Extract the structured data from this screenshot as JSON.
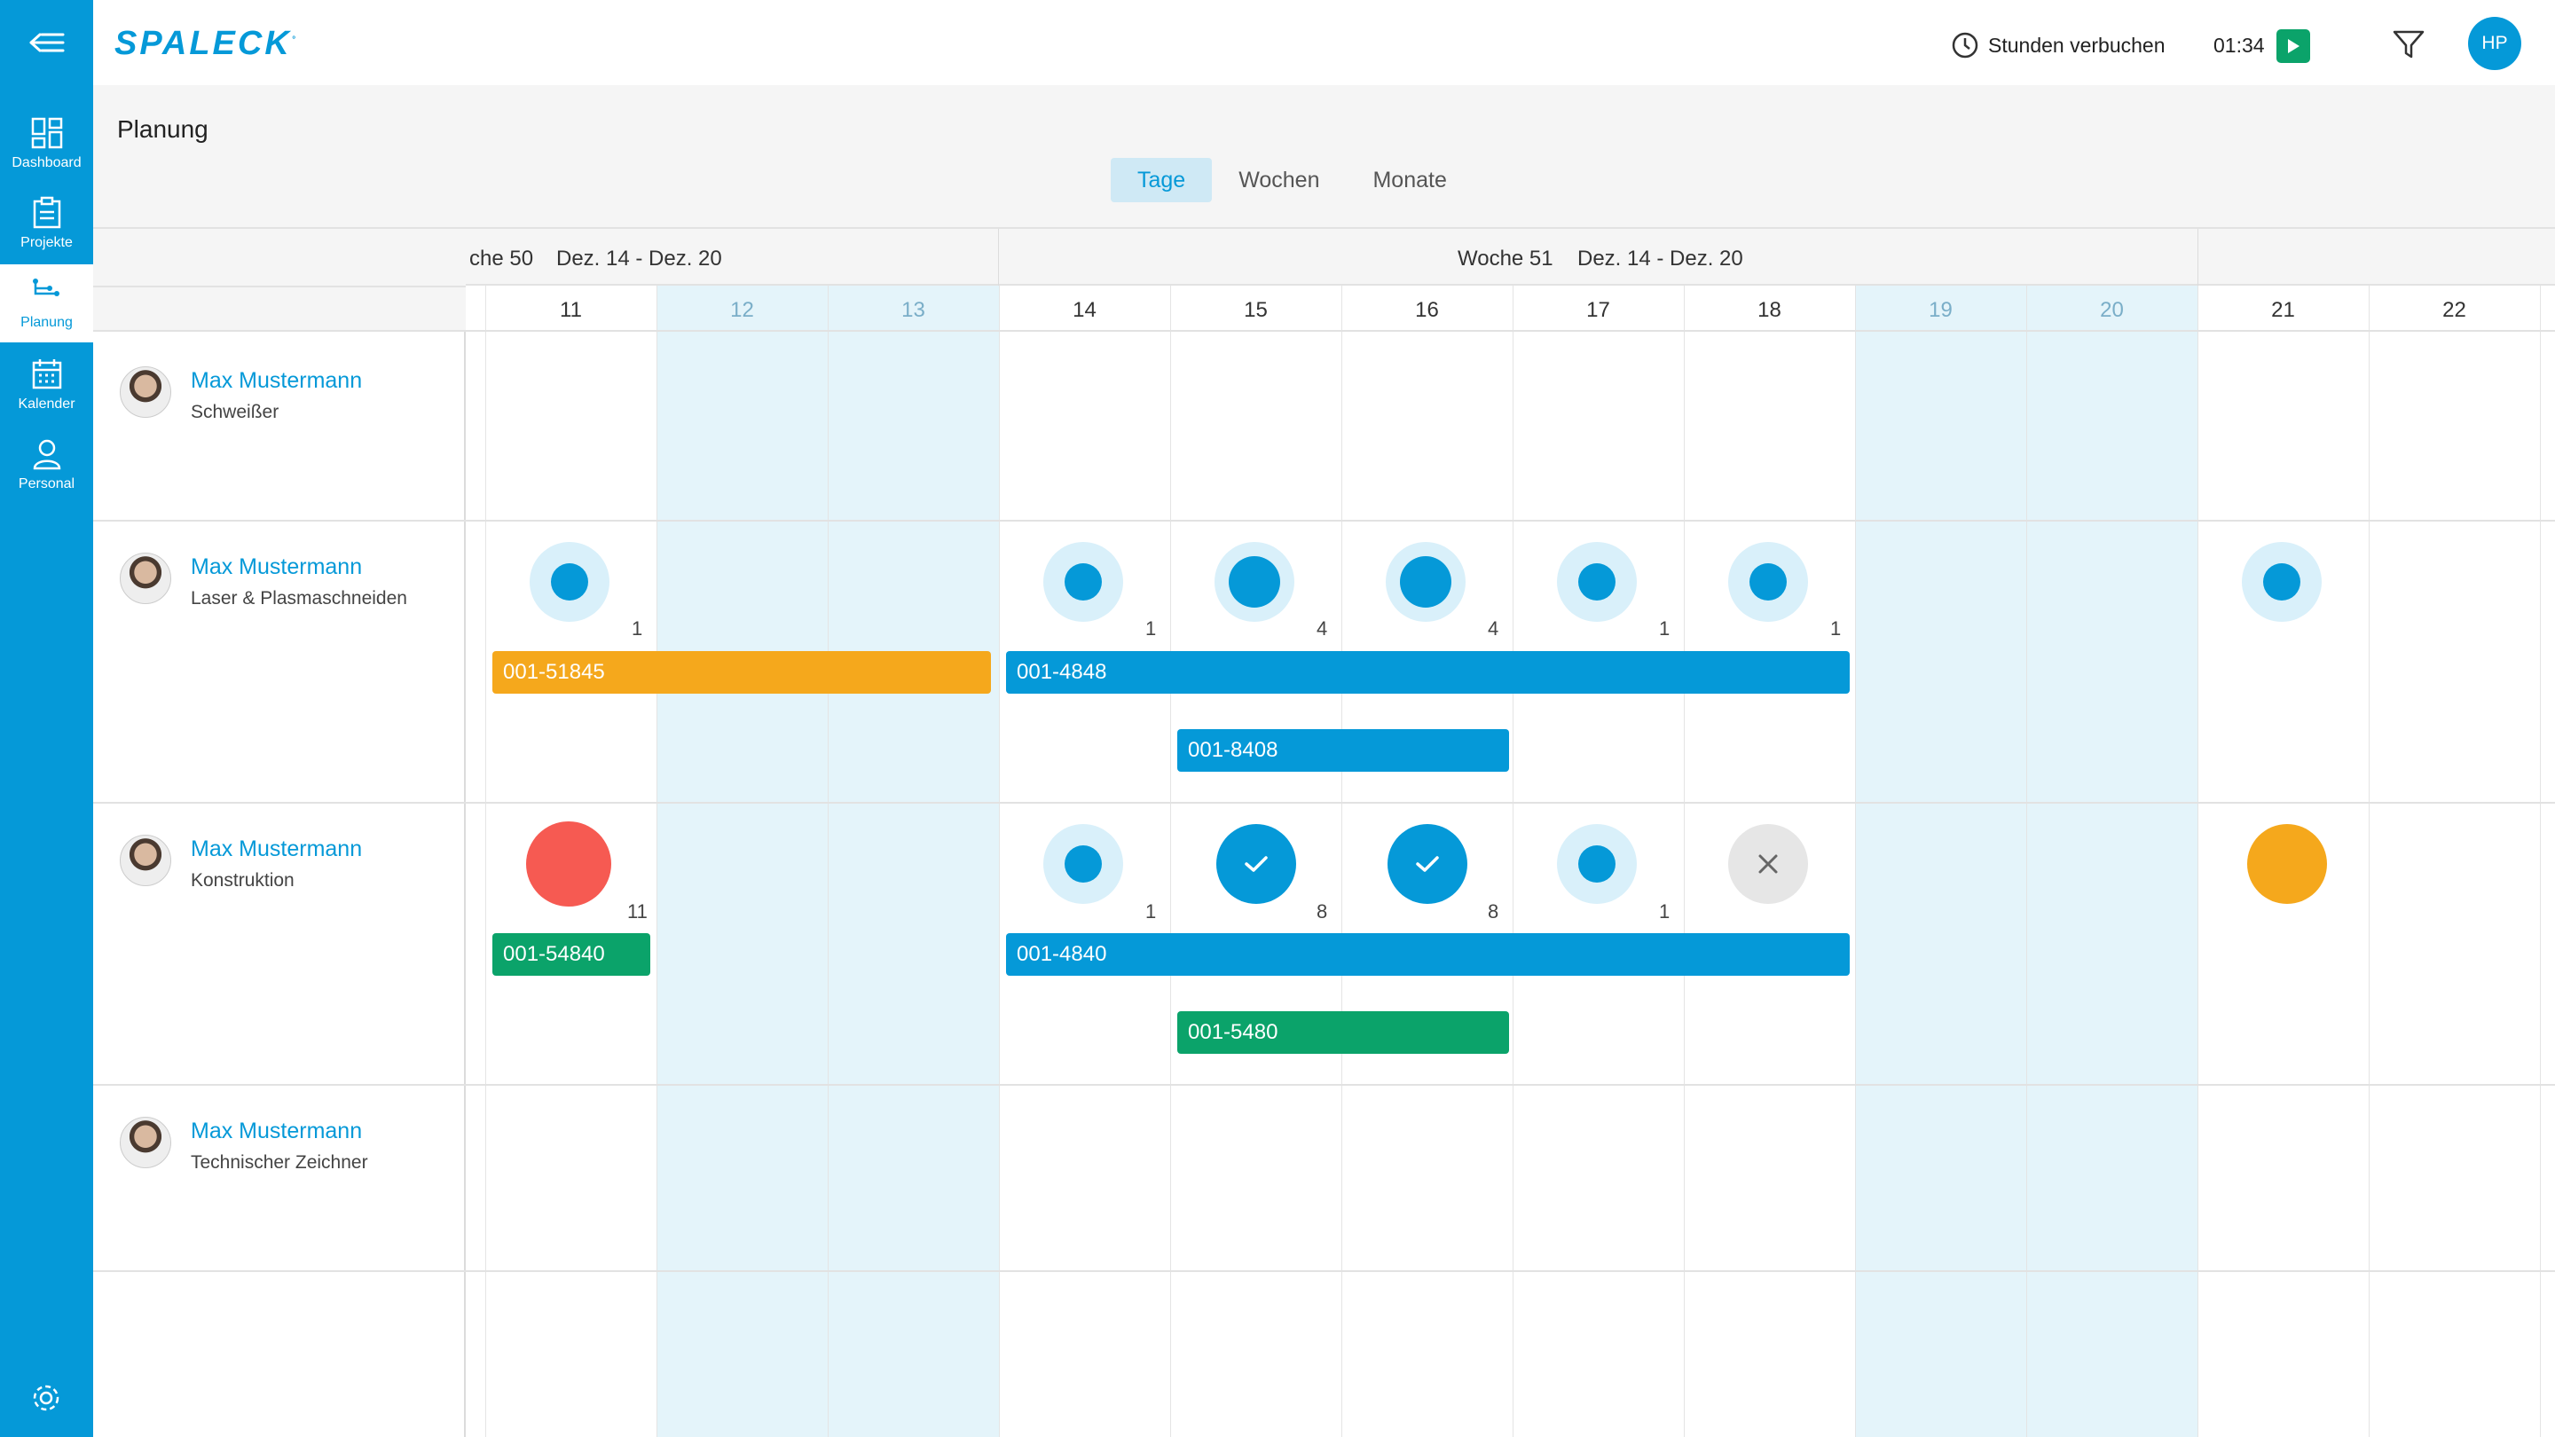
{
  "sidebar": {
    "items": [
      {
        "label": "Dashboard",
        "icon": "dashboard-icon"
      },
      {
        "label": "Projekte",
        "icon": "clipboard-icon"
      },
      {
        "label": "Planung",
        "icon": "planning-icon",
        "active": true
      },
      {
        "label": "Kalender",
        "icon": "calendar-icon"
      },
      {
        "label": "Personal",
        "icon": "person-icon"
      }
    ]
  },
  "header": {
    "logo": "SPALECK",
    "book_hours_label": "Stunden verbuchen",
    "timer": "01:34",
    "user_initials": "HP"
  },
  "page": {
    "title": "Planung",
    "tabs": [
      "Tage",
      "Wochen",
      "Monate"
    ],
    "active_tab": "Tage"
  },
  "calendar": {
    "weeks": [
      {
        "label": "che 50",
        "range": "Dez. 14 - Dez. 20"
      },
      {
        "label": "Woche 51",
        "range": "Dez. 14 - Dez. 20"
      }
    ],
    "days": [
      "11",
      "12",
      "13",
      "14",
      "15",
      "16",
      "17",
      "18",
      "19",
      "20",
      "21",
      "22"
    ],
    "weekend_days": [
      "12",
      "13",
      "19",
      "20"
    ]
  },
  "people": [
    {
      "name": "Max Mustermann",
      "role": "Schweißer"
    },
    {
      "name": "Max Mustermann",
      "role": "Laser & Plasmaschneiden",
      "markers": [
        {
          "day": "11",
          "kind": "dot",
          "count": "1"
        },
        {
          "day": "14",
          "kind": "dot",
          "count": "1"
        },
        {
          "day": "15",
          "kind": "dot-big",
          "count": "4"
        },
        {
          "day": "16",
          "kind": "dot-big",
          "count": "4"
        },
        {
          "day": "17",
          "kind": "dot",
          "count": "1"
        },
        {
          "day": "18",
          "kind": "dot",
          "count": "1"
        },
        {
          "day": "21",
          "kind": "dot",
          "count": ""
        }
      ],
      "bars": [
        {
          "label": "001-51845",
          "color": "#f5a81c"
        },
        {
          "label": "001-4848",
          "color": "#0599d8"
        },
        {
          "label": "001-8408",
          "color": "#0599d8"
        }
      ]
    },
    {
      "name": "Max Mustermann",
      "role": "Konstruktion",
      "markers": [
        {
          "day": "11",
          "kind": "red-circle",
          "count": "11"
        },
        {
          "day": "14",
          "kind": "dot",
          "count": "1"
        },
        {
          "day": "15",
          "kind": "check",
          "count": "8"
        },
        {
          "day": "16",
          "kind": "check",
          "count": "8"
        },
        {
          "day": "17",
          "kind": "dot",
          "count": "1"
        },
        {
          "day": "18",
          "kind": "cross",
          "count": ""
        },
        {
          "day": "21",
          "kind": "orange-circle",
          "count": ""
        }
      ],
      "bars": [
        {
          "label": "001-54840",
          "color": "#0ba36a"
        },
        {
          "label": "001-4840",
          "color": "#0599d8"
        },
        {
          "label": "001-5480",
          "color": "#0ba36a"
        }
      ]
    },
    {
      "name": "Max Mustermann",
      "role": "Technischer Zeichner"
    }
  ],
  "colors": {
    "primary": "#0599d8",
    "weekend": "#e4f4fa",
    "green": "#0ba36a",
    "orange": "#f5a81c",
    "red": "#f65a52"
  }
}
